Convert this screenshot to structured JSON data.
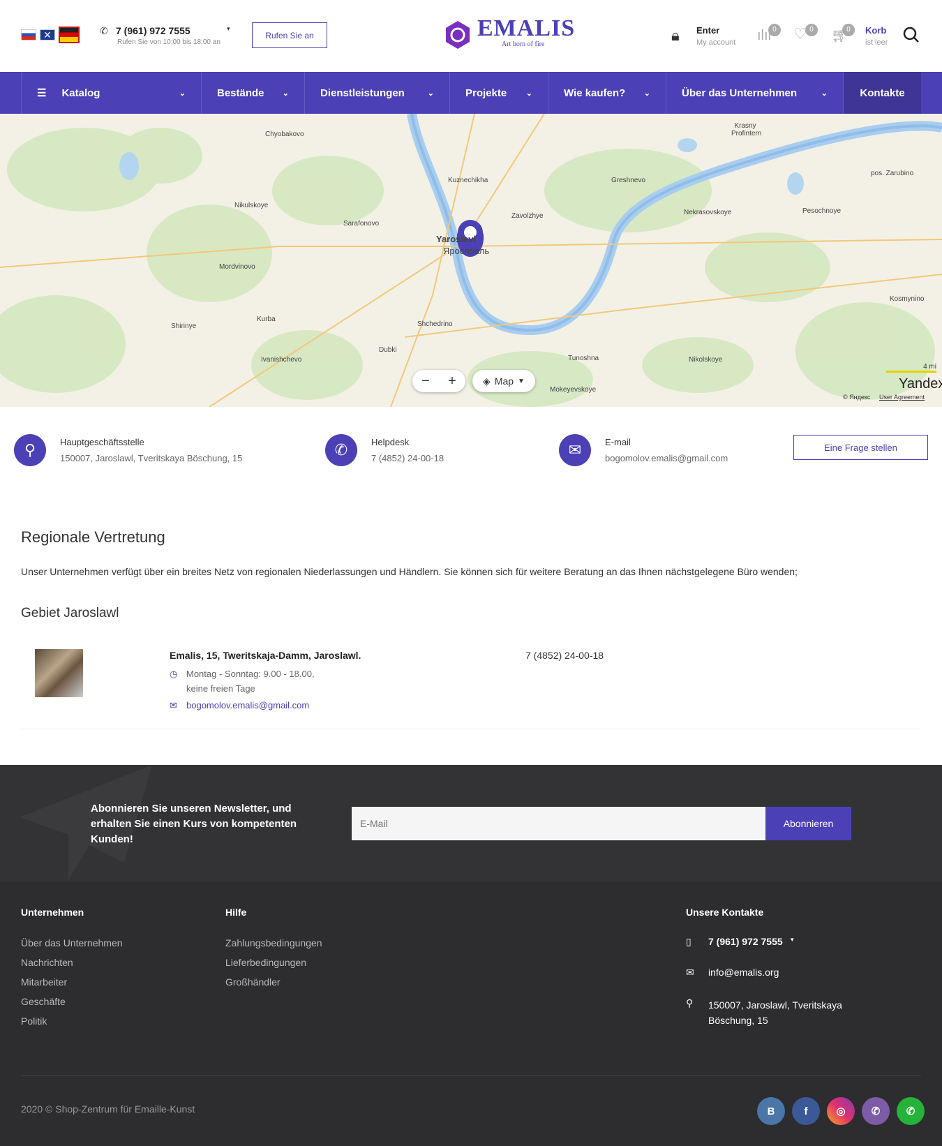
{
  "header": {
    "languages": [
      "ru",
      "en",
      "de"
    ],
    "phone": "7 (961) 972 7555",
    "phone_hours": "Rufen Sie von 10:00 bis 18:00 an",
    "callback_button": "Rufen Sie an",
    "logo_text": "EMALIS",
    "logo_tagline": "Art born of fire",
    "account_title": "Enter",
    "account_sub": "My account",
    "compare_count": "0",
    "wishlist_count": "0",
    "cart_count": "0",
    "cart_title": "Korb",
    "cart_sub": "ist leer",
    "accent": "#4b40b5"
  },
  "nav": {
    "items": [
      {
        "label": "Katalog"
      },
      {
        "label": "Bestände"
      },
      {
        "label": "Dienstleistungen"
      },
      {
        "label": "Projekte"
      },
      {
        "label": "Wie kaufen?"
      },
      {
        "label": "Über das Unternehmen"
      },
      {
        "label": "Kontakte"
      }
    ]
  },
  "map": {
    "city": "Yaroslavl",
    "city_ru": "Ярославль",
    "labels": [
      "Chyobakovo",
      "Kuznechikha",
      "Greshnevo",
      "Krasny Profintern",
      "Nikulskoye",
      "Sarafonovo",
      "Zavolzhye",
      "Nekrasovskoye",
      "Pesochnoye",
      "pos. Zarubino",
      "Mordvinovo",
      "Shchedrino",
      "Kosmynino",
      "Shirinye",
      "Kurba",
      "Dubki",
      "Tunoshna",
      "Nikolskoye",
      "Ivanishchevo",
      "Mokeyevskoye"
    ],
    "map_type": "Map",
    "scale": "4 mi",
    "brand": "Yandex",
    "copyright": "© Яндекс",
    "agreement": "User Agreement"
  },
  "contacts": {
    "office_label": "Hauptgeschäftsstelle",
    "office_value": "150007, Jaroslawl, Tveritskaya Böschung, 15",
    "helpdesk_label": "Helpdesk",
    "helpdesk_value": "7 (4852) 24-00-18",
    "email_label": "E-mail",
    "email_value": "bogomolov.emalis@gmail.com",
    "ask_button": "Eine Frage stellen"
  },
  "regional": {
    "title": "Regionale Vertretung",
    "text": "Unser Unternehmen verfügt über ein breites Netz von regionalen Niederlassungen und Händlern. Sie können sich für weitere Beratung an das Ihnen nächstgelegene Büro wenden;",
    "region_title": "Gebiet Jaroslawl",
    "store": {
      "name": "Emalis, 15, Tweritskaja-Damm, Jaroslawl.",
      "hours": "Montag - Sonntag: 9.00 - 18.00,",
      "hours2": "keine freien Tage",
      "email": "bogomolov.emalis@gmail.com",
      "phone": "7 (4852) 24-00-18"
    }
  },
  "newsletter": {
    "text": "Abonnieren Sie unseren Newsletter, und erhalten Sie einen Kurs von kompetenten Kunden!",
    "placeholder": "E-Mail",
    "button": "Abonnieren"
  },
  "footer": {
    "col1_title": "Unternehmen",
    "col1": [
      "Über das Unternehmen",
      "Nachrichten",
      "Mitarbeiter",
      "Geschäfte",
      "Politik"
    ],
    "col2_title": "Hilfe",
    "col2": [
      "Zahlungsbedingungen",
      "Lieferbedingungen",
      "Großhändler"
    ],
    "col3_title": "Unsere Kontakte",
    "phone": "7 (961) 972 7555",
    "email": "info@emalis.org",
    "address": "150007, Jaroslawl, Tveritskaya Böschung, 15",
    "copyright": "2020 © Shop-Zentrum für Emaille-Kunst",
    "social": [
      "vk",
      "facebook",
      "instagram",
      "viber",
      "whatsapp"
    ]
  }
}
